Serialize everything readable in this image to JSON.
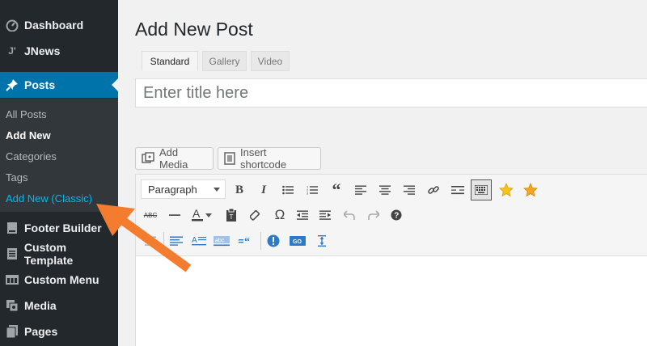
{
  "sidebar": {
    "items": [
      {
        "label": "Dashboard",
        "icon": "dashboard-icon"
      },
      {
        "label": "JNews",
        "icon": "jnews-icon"
      },
      {
        "label": "Posts",
        "icon": "pin-icon"
      },
      {
        "label": "Footer Builder",
        "icon": "footer-builder-icon"
      },
      {
        "label": "Custom Template",
        "icon": "custom-template-icon"
      },
      {
        "label": "Custom Menu",
        "icon": "custom-menu-icon"
      },
      {
        "label": "Media",
        "icon": "media-icon"
      },
      {
        "label": "Pages",
        "icon": "pages-icon"
      }
    ],
    "submenu": [
      {
        "label": "All Posts"
      },
      {
        "label": "Add New"
      },
      {
        "label": "Categories"
      },
      {
        "label": "Tags"
      },
      {
        "label": "Add New (Classic)"
      }
    ]
  },
  "main": {
    "title": "Add New Post",
    "format_tabs": [
      "Standard",
      "Gallery",
      "Video"
    ],
    "title_placeholder": "Enter title here",
    "add_media_label": "Add Media",
    "shortcode_label": "Insert shortcode",
    "format_select_value": "Paragraph"
  },
  "colors": {
    "sidebar_bg": "#23282d",
    "submenu_bg": "#32373c",
    "active_blue": "#0073aa",
    "highlight_link": "#00b9eb",
    "arrow_orange": "#f47c2e",
    "star_yellow": "#f5c518"
  }
}
